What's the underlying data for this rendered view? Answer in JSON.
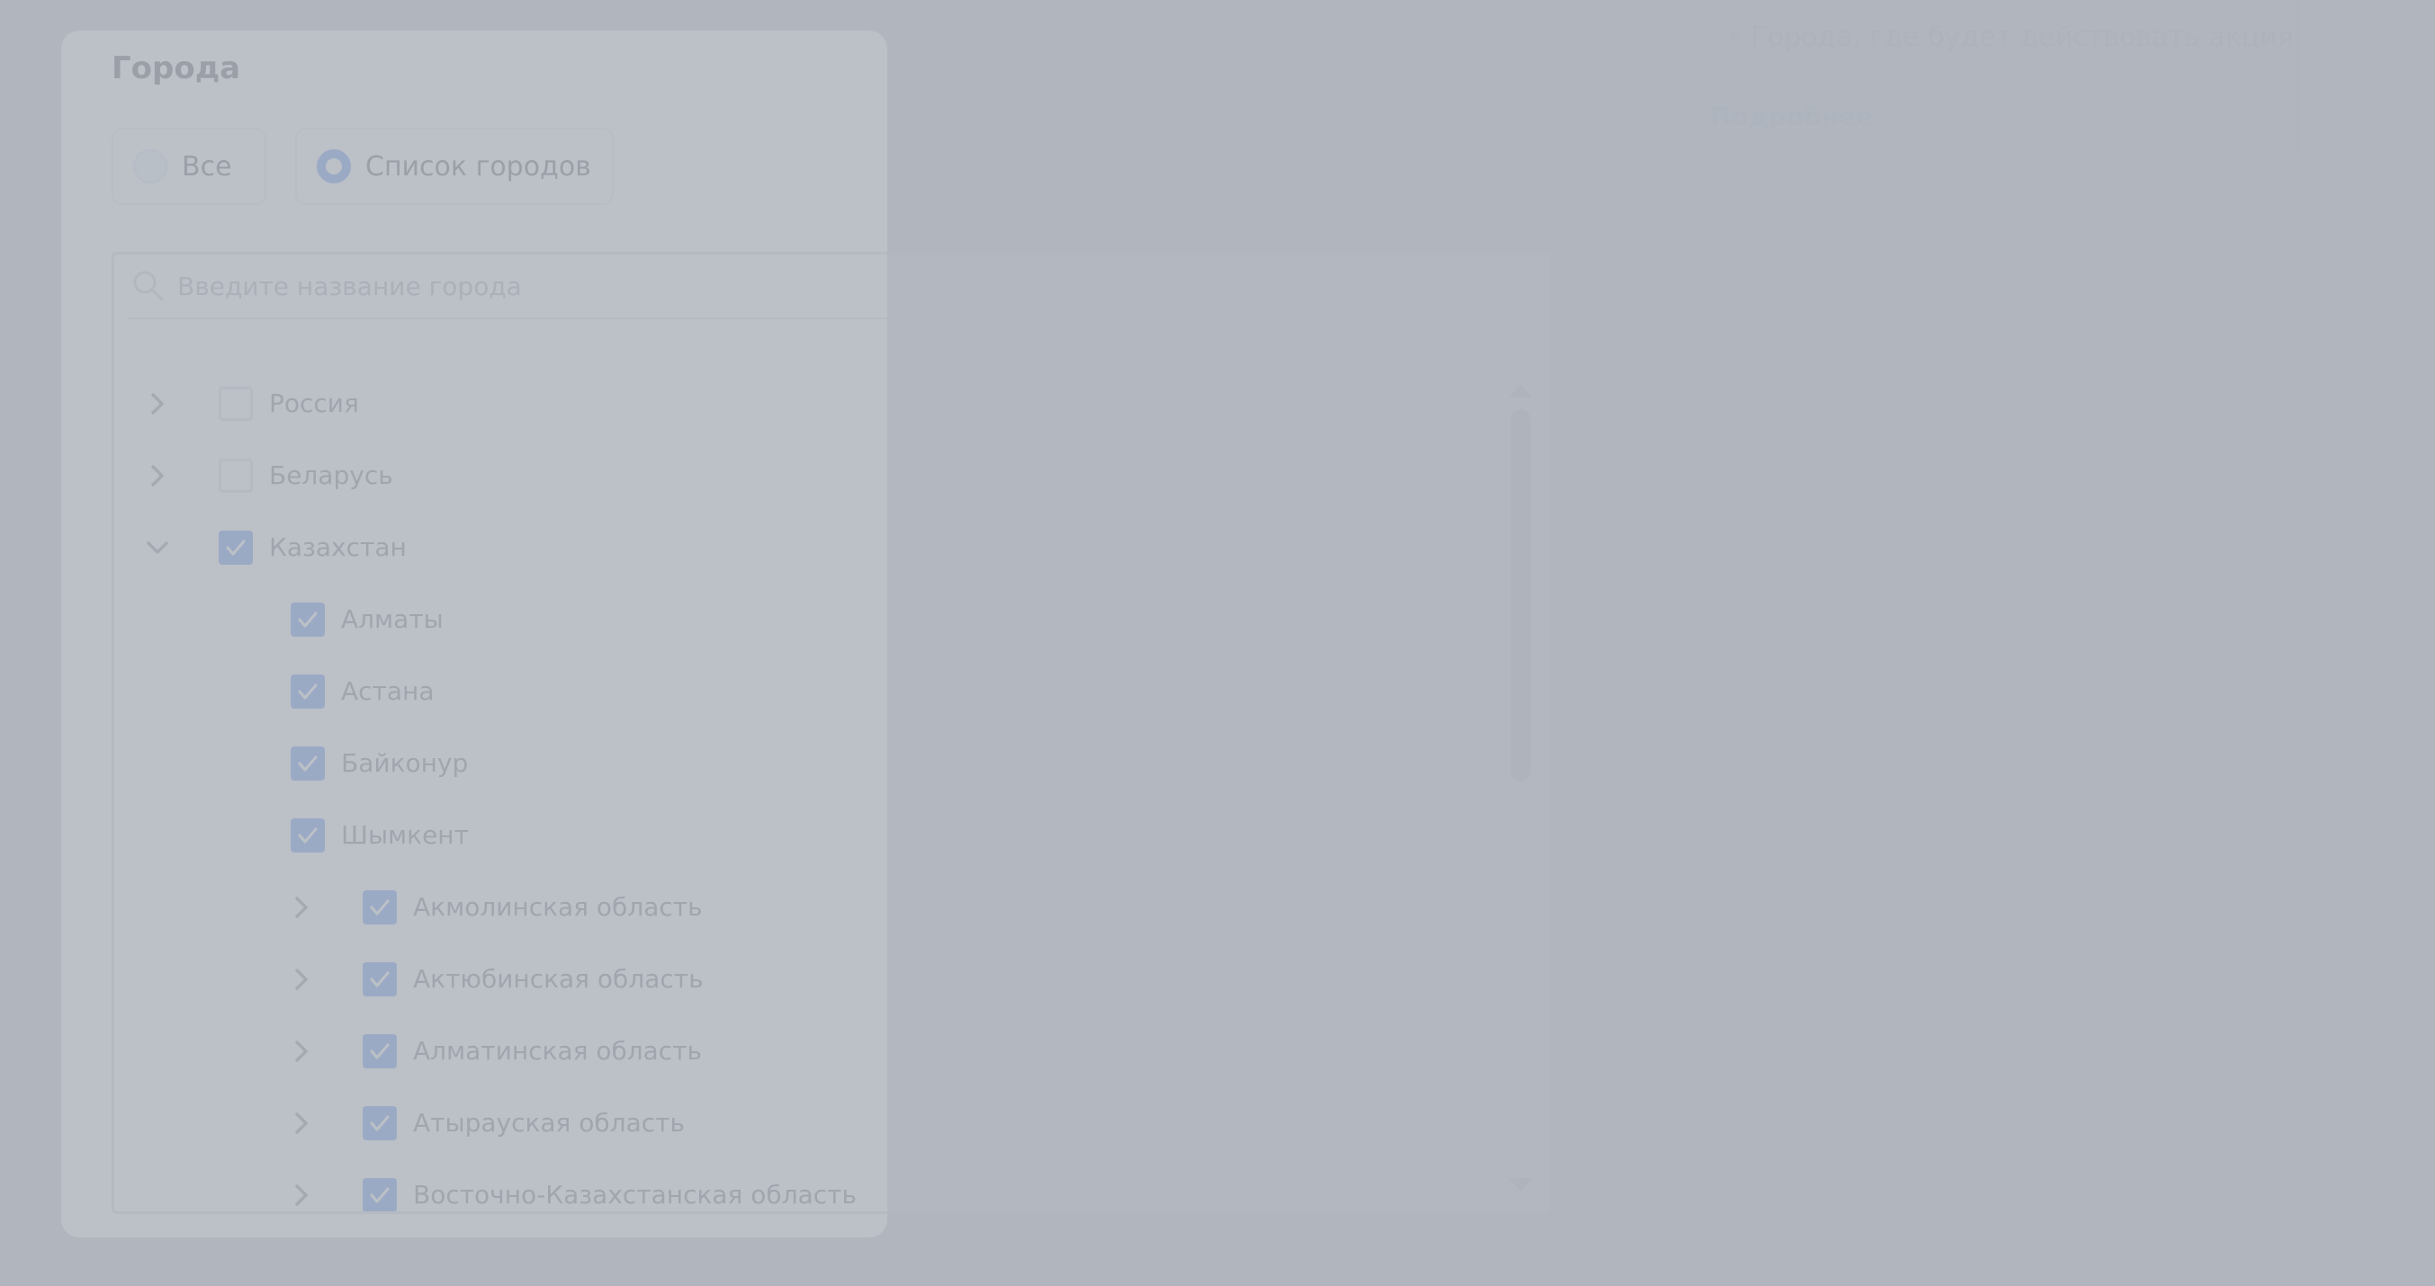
{
  "cities_section": {
    "title": "Города",
    "radio_options": [
      {
        "label": "Все",
        "selected": false
      },
      {
        "label": "Список городов",
        "selected": true
      }
    ],
    "search": {
      "placeholder": "Введите название города",
      "value": ""
    },
    "tree": [
      {
        "label": "Россия",
        "level": 0,
        "expandable": true,
        "expanded": false,
        "checked": false
      },
      {
        "label": "Беларусь",
        "level": 0,
        "expandable": true,
        "expanded": false,
        "checked": false
      },
      {
        "label": "Казахстан",
        "level": 0,
        "expandable": true,
        "expanded": true,
        "checked": true
      },
      {
        "label": "Алматы",
        "level": 1,
        "expandable": false,
        "checked": true
      },
      {
        "label": "Астана",
        "level": 1,
        "expandable": false,
        "checked": true
      },
      {
        "label": "Байконур",
        "level": 1,
        "expandable": false,
        "checked": true
      },
      {
        "label": "Шымкент",
        "level": 1,
        "expandable": false,
        "checked": true
      },
      {
        "label": "Акмолинская область",
        "level": 2,
        "expandable": true,
        "expanded": false,
        "checked": true
      },
      {
        "label": "Актюбинская область",
        "level": 2,
        "expandable": true,
        "expanded": false,
        "checked": true
      },
      {
        "label": "Алматинская область",
        "level": 2,
        "expandable": true,
        "expanded": false,
        "checked": true
      },
      {
        "label": "Атырауская область",
        "level": 2,
        "expandable": true,
        "expanded": false,
        "checked": true
      },
      {
        "label": "Восточно-Казахстанская область",
        "level": 2,
        "expandable": true,
        "expanded": false,
        "checked": true
      }
    ]
  },
  "info_card": {
    "bullet": "Города, где будет действовать акция",
    "link": "Подробнее"
  },
  "colors": {
    "accent": "#1565e6",
    "link": "#174ea6",
    "overlay": "#b1b6be"
  }
}
